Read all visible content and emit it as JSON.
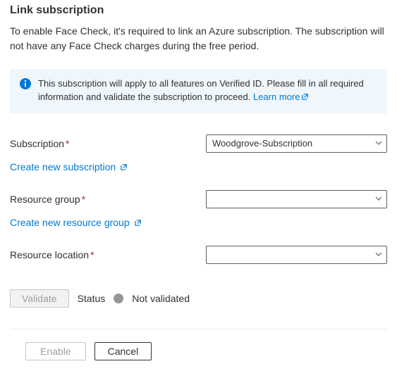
{
  "title": "Link subscription",
  "intro": "To enable Face Check, it's required to link an Azure subscription. The subscription will not have any Face Check charges during the free period.",
  "callout": {
    "text": "This subscription will apply to all features on Verified ID. Please fill in all required information and validate the subscription to proceed. ",
    "learn_more": "Learn more"
  },
  "form": {
    "subscription": {
      "label": "Subscription",
      "value": "Woodgrove-Subscription",
      "create_link": "Create new subscription"
    },
    "resource_group": {
      "label": "Resource group",
      "value": "",
      "create_link": "Create new resource group"
    },
    "resource_location": {
      "label": "Resource location",
      "value": ""
    }
  },
  "validate": {
    "button": "Validate",
    "status_label": "Status",
    "status_text": "Not validated"
  },
  "footer": {
    "enable": "Enable",
    "cancel": "Cancel"
  }
}
